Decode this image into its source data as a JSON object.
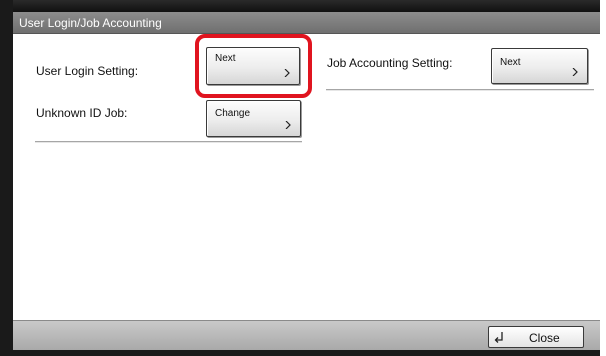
{
  "window": {
    "title": "User Login/Job Accounting"
  },
  "settings": {
    "user_login_label": "User Login Setting:",
    "user_login_button": "Next",
    "job_accounting_label": "Job Accounting Setting:",
    "job_accounting_button": "Next",
    "unknown_id_label": "Unknown ID Job:",
    "unknown_id_button": "Change"
  },
  "footer": {
    "close_label": "Close",
    "close_icon": "return-arrow-icon"
  },
  "icons": {
    "button_chevron": "chevron-right-icon"
  },
  "colors": {
    "title_bar": "#7c7c7c",
    "highlight": "#e0141f",
    "bottom_bar": "#b8b8b8"
  }
}
